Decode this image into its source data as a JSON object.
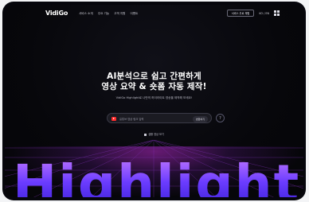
{
  "header": {
    "logo": "VidiGo",
    "menu": [
      "서비스 소개",
      "주요 기능",
      "고객 지원",
      "이벤트"
    ],
    "upgrade_label": "서비스 무료 체험",
    "lang_label": "KO / EN",
    "menu_icon": "grid-icon"
  },
  "hero": {
    "title_line1": "AI분석으로 쉽고 간편하게",
    "title_line2": "영상 요약 & 숏폼 자동 제작!",
    "subtitle": "VidiGo Highlight로 나만의 하이라이트 영상을 제작해 보세요!"
  },
  "search": {
    "placeholder": "유튜브 영상 링크 입력",
    "button_label": "변환하기",
    "icon": "youtube-icon"
  },
  "help": {
    "label": "?"
  },
  "sample_link": "샘플 영상 보기",
  "footer_word": "Highlight",
  "colors": {
    "background": "#07070b",
    "accent": "#6b3cff",
    "glow": "#b428c8"
  }
}
